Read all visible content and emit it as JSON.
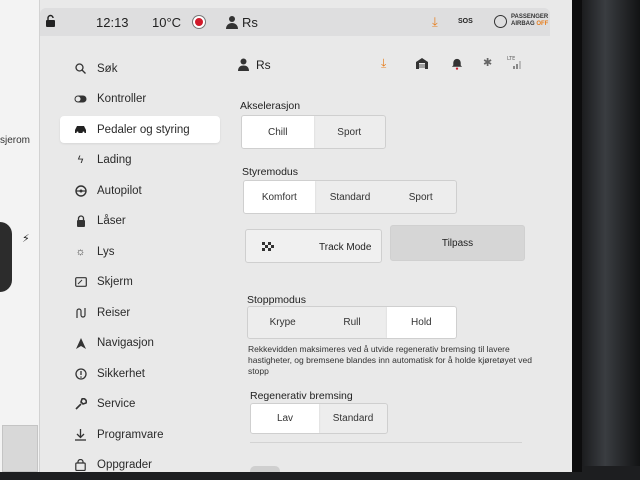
{
  "status_bar": {
    "time": "12:13",
    "temperature": "10°C",
    "user": "Rs",
    "sos": "SOS",
    "airbag_line1": "PASSENGER",
    "airbag_line2": "AIRBAG",
    "airbag_state": "OFF"
  },
  "left_panel": {
    "partial_text": "sjerom"
  },
  "sidebar": {
    "items": [
      {
        "label": "Søk",
        "icon": "search-icon"
      },
      {
        "label": "Kontroller",
        "icon": "toggle-icon"
      },
      {
        "label": "Pedaler og styring",
        "icon": "car-icon"
      },
      {
        "label": "Lading",
        "icon": "bolt-icon"
      },
      {
        "label": "Autopilot",
        "icon": "steering-wheel-icon"
      },
      {
        "label": "Låser",
        "icon": "lock-icon"
      },
      {
        "label": "Lys",
        "icon": "sun-icon"
      },
      {
        "label": "Skjerm",
        "icon": "display-icon"
      },
      {
        "label": "Reiser",
        "icon": "route-icon"
      },
      {
        "label": "Navigasjon",
        "icon": "navigation-arrow-icon"
      },
      {
        "label": "Sikkerhet",
        "icon": "safety-icon"
      },
      {
        "label": "Service",
        "icon": "wrench-icon"
      },
      {
        "label": "Programvare",
        "icon": "download-icon"
      },
      {
        "label": "Oppgrader",
        "icon": "shopping-bag-icon"
      }
    ],
    "active_index": 2
  },
  "content_header": {
    "user": "Rs",
    "signal_label": "LTE"
  },
  "acceleration": {
    "label": "Akselerasjon",
    "options": [
      "Chill",
      "Sport"
    ],
    "selected": "Chill"
  },
  "steering_mode": {
    "label": "Styremodus",
    "options": [
      "Komfort",
      "Standard",
      "Sport"
    ],
    "selected": "Komfort"
  },
  "track_mode": {
    "label": "Track Mode",
    "customize_label": "Tilpass"
  },
  "stopping_mode": {
    "label": "Stoppmodus",
    "options": [
      "Krype",
      "Rull",
      "Hold"
    ],
    "selected": "Hold",
    "description": "Rekkevidden maksimeres ved å utvide regenerativ bremsing til lavere hastigheter, og bremsene blandes inn automatisk for å holde kjøretøyet ved stopp"
  },
  "regen_braking": {
    "label": "Regenerativ bremsing",
    "options": [
      "Lav",
      "Standard"
    ],
    "selected": "Lav"
  },
  "colors": {
    "accent_orange": "#e67e1e",
    "record_red": "#d11a2a",
    "screen_bg": "#e9e9e9"
  }
}
